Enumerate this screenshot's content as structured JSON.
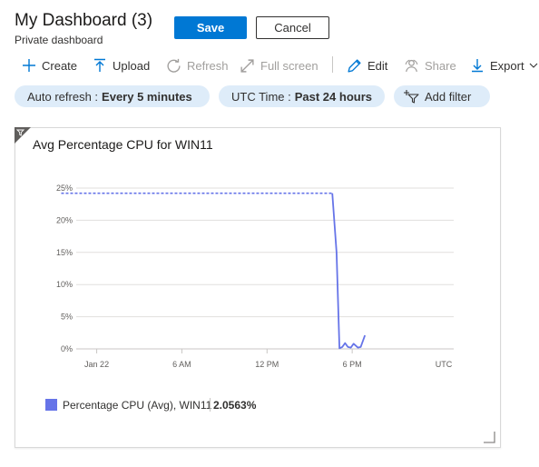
{
  "header": {
    "title": "My Dashboard (3)",
    "subtitle": "Private dashboard",
    "save_label": "Save",
    "cancel_label": "Cancel"
  },
  "toolbar": {
    "create": "Create",
    "upload": "Upload",
    "refresh": "Refresh",
    "full_screen": "Full screen",
    "edit": "Edit",
    "share": "Share",
    "export": "Export"
  },
  "filters": {
    "auto_refresh_label": "Auto refresh :",
    "auto_refresh_value": "Every 5 minutes",
    "time_label": "UTC Time :",
    "time_value": "Past 24 hours",
    "add_filter": "Add filter"
  },
  "tile": {
    "title": "Avg Percentage CPU for WIN11",
    "legend_label": "Percentage CPU (Avg), WIN11",
    "legend_value": "2.0563%"
  },
  "colors": {
    "accent": "#0078d4",
    "series": "#6674e8",
    "pill_bg": "#deecf9"
  },
  "chart_data": {
    "type": "line",
    "x_tick_labels": [
      "Jan 22",
      "6 AM",
      "12 PM",
      "6 PM"
    ],
    "x_unit_label": "UTC",
    "y_tick_labels": [
      "0%",
      "5%",
      "10%",
      "15%",
      "20%",
      "25%"
    ],
    "ylim": [
      0,
      25
    ],
    "grid": true,
    "series": [
      {
        "name": "Percentage CPU (Avg), WIN11",
        "color": "#6674e8",
        "dashed_segment": {
          "x": [
            -2.5,
            16.6
          ],
          "y": [
            24.2,
            24.2
          ]
        },
        "x": [
          16.6,
          16.9,
          17.1,
          17.3,
          17.5,
          17.7,
          17.9,
          18.1,
          18.4,
          18.6,
          18.9
        ],
        "y": [
          24.2,
          15.0,
          0.1,
          0.3,
          0.9,
          0.3,
          0.2,
          0.8,
          0.2,
          0.3,
          2.1
        ]
      }
    ]
  }
}
